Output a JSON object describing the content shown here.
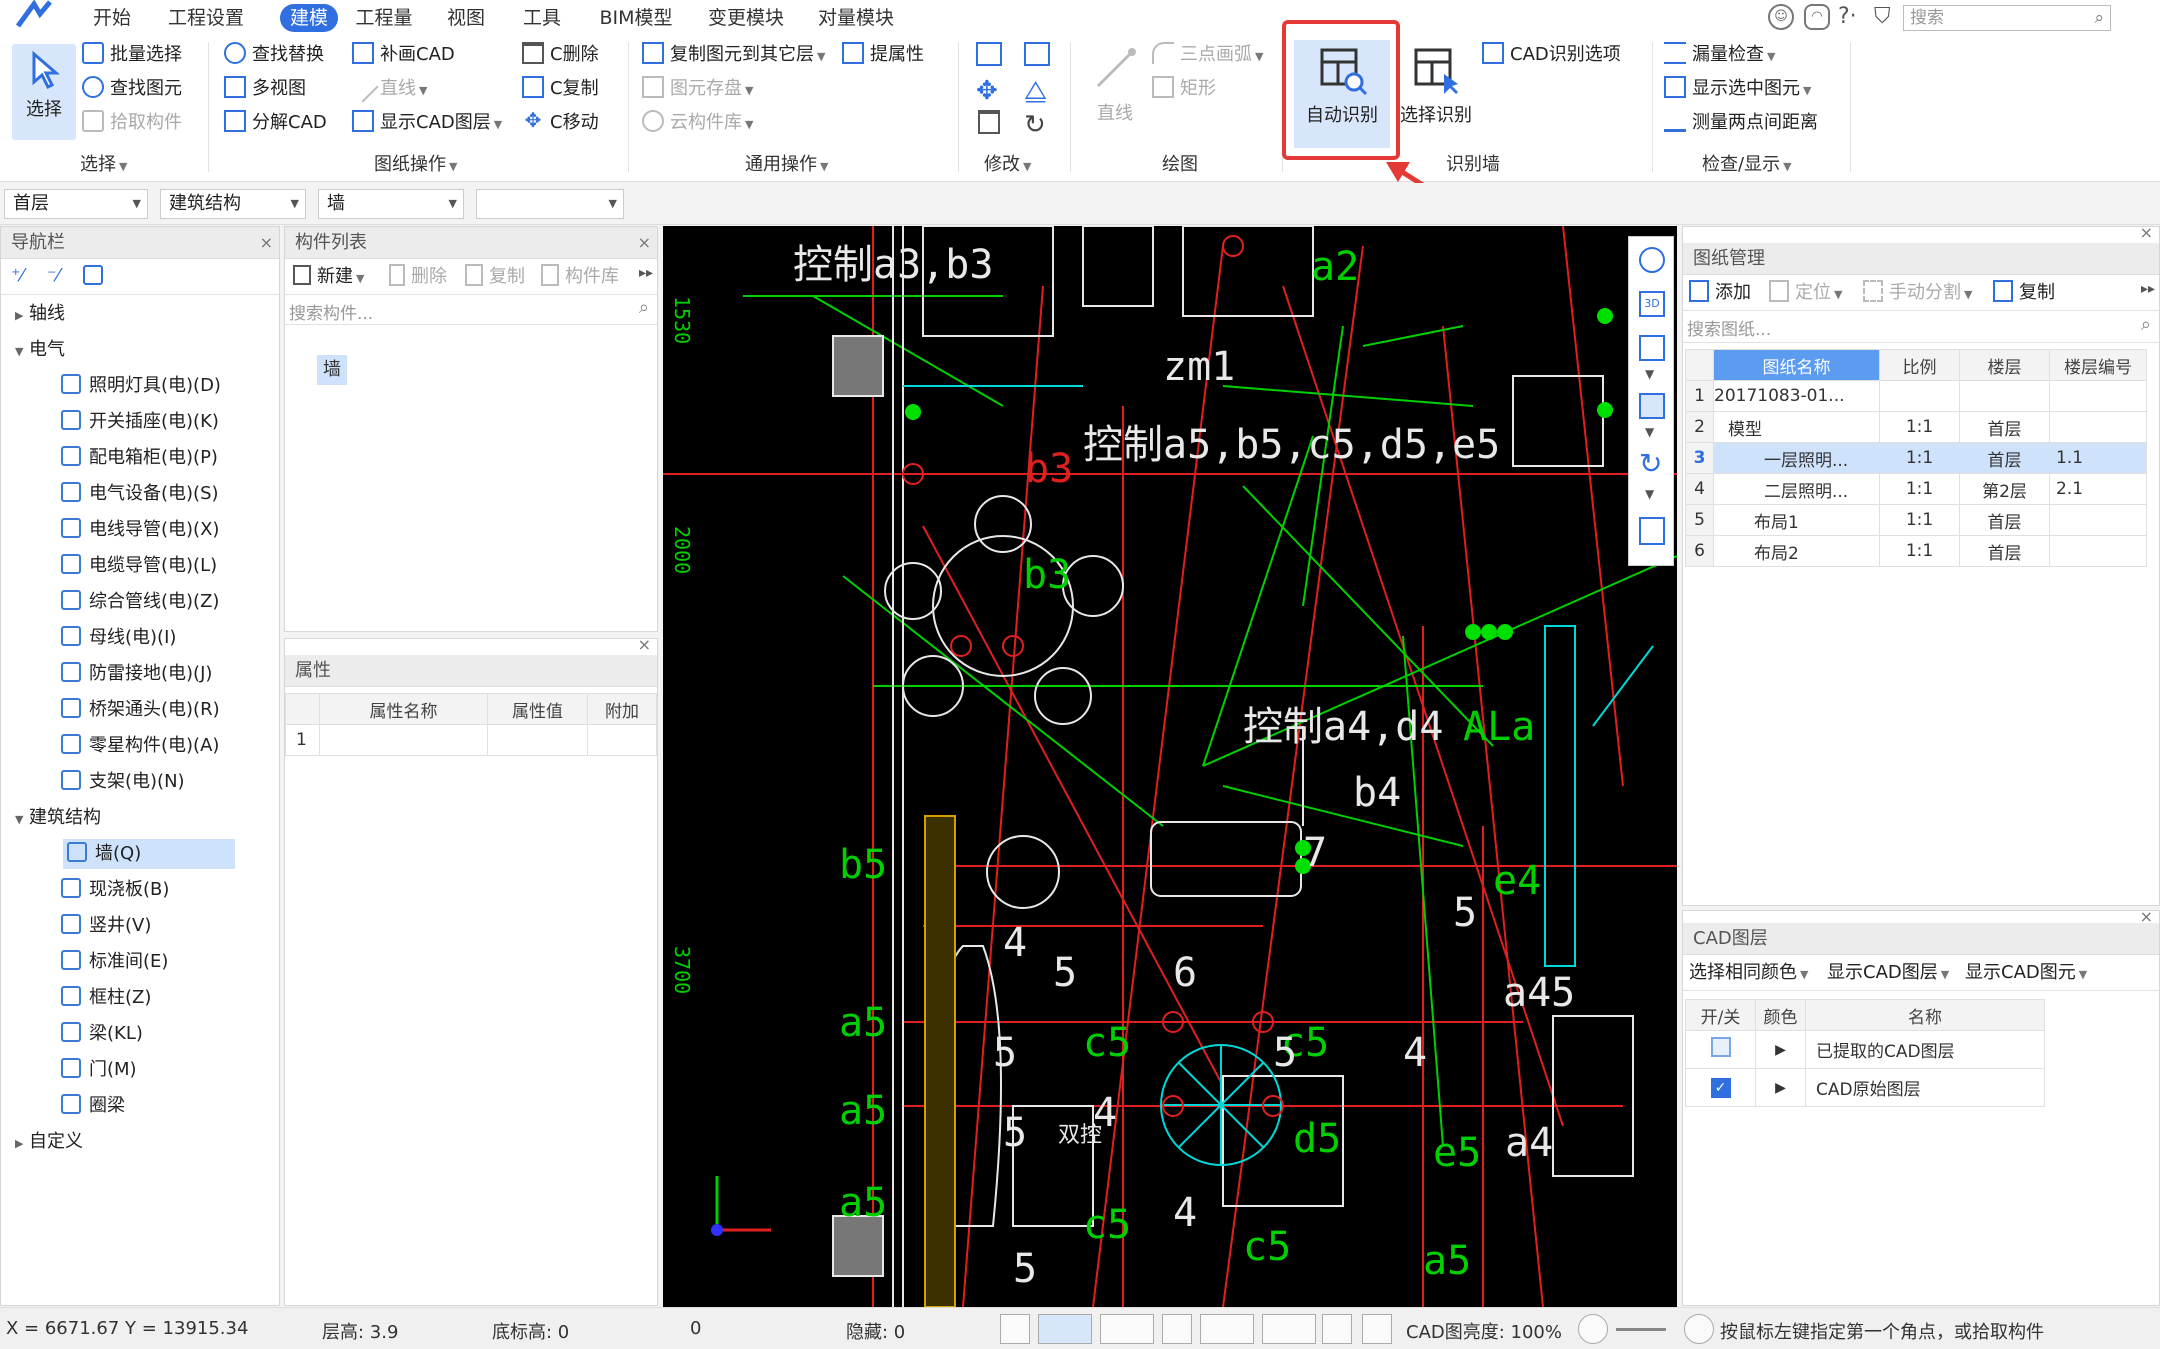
{
  "menu": {
    "tabs": [
      "开始",
      "工程设置",
      "建模",
      "工程量",
      "视图",
      "工具",
      "BIM模型",
      "变更模块",
      "对量模块"
    ],
    "active_tab": "建模",
    "search_placeholder": "搜索"
  },
  "ribbon": {
    "select_group": {
      "big_button": "选择",
      "items": [
        "批量选择",
        "查找图元",
        "拾取构件"
      ],
      "label": "选择"
    },
    "drawing_ops": {
      "items": [
        "查找替换",
        "多视图",
        "分解CAD",
        "补画CAD",
        "直线",
        "显示CAD图层",
        "C删除",
        "C复制",
        "C移动"
      ],
      "label": "图纸操作"
    },
    "general_ops": {
      "items": [
        "复制图元到其它层",
        "提属性",
        "图元存盘",
        "云构件库"
      ],
      "label": "通用操作"
    },
    "modify": {
      "label": "修改"
    },
    "draw": {
      "items": [
        "直线",
        "三点画弧",
        "矩形"
      ],
      "label": "绘图"
    },
    "recognize_wall": {
      "auto_recognize": "自动识别",
      "select_recognize": "选择识别",
      "cad_option": "CAD识别选项",
      "label": "识别墙"
    },
    "check_display": {
      "items": [
        "漏量检查",
        "显示选中图元",
        "测量两点间距离"
      ],
      "label": "检查/显示"
    }
  },
  "selectors": [
    "首层",
    "建筑结构",
    "墙",
    ""
  ],
  "nav": {
    "title": "导航栏",
    "tree": [
      {
        "label": "轴线",
        "level": 0,
        "expanded": false
      },
      {
        "label": "电气",
        "level": 0,
        "expanded": true
      },
      {
        "label": "照明灯具(电)(D)",
        "level": 1
      },
      {
        "label": "开关插座(电)(K)",
        "level": 1
      },
      {
        "label": "配电箱柜(电)(P)",
        "level": 1
      },
      {
        "label": "电气设备(电)(S)",
        "level": 1
      },
      {
        "label": "电线导管(电)(X)",
        "level": 1
      },
      {
        "label": "电缆导管(电)(L)",
        "level": 1
      },
      {
        "label": "综合管线(电)(Z)",
        "level": 1
      },
      {
        "label": "母线(电)(I)",
        "level": 1
      },
      {
        "label": "防雷接地(电)(J)",
        "level": 1
      },
      {
        "label": "桥架通头(电)(R)",
        "level": 1
      },
      {
        "label": "零星构件(电)(A)",
        "level": 1
      },
      {
        "label": "支架(电)(N)",
        "level": 1
      },
      {
        "label": "建筑结构",
        "level": 0,
        "expanded": true
      },
      {
        "label": "墙(Q)",
        "level": 1,
        "selected": true
      },
      {
        "label": "现浇板(B)",
        "level": 1
      },
      {
        "label": "竖井(V)",
        "level": 1
      },
      {
        "label": "标准间(E)",
        "level": 1
      },
      {
        "label": "框柱(Z)",
        "level": 1
      },
      {
        "label": "梁(KL)",
        "level": 1
      },
      {
        "label": "门(M)",
        "level": 1
      },
      {
        "label": "圈梁",
        "level": 1
      },
      {
        "label": "自定义",
        "level": 0,
        "expanded": false
      }
    ]
  },
  "component_list": {
    "title": "构件列表",
    "toolbar": [
      "新建",
      "删除",
      "复制",
      "构件库"
    ],
    "search_placeholder": "搜索构件...",
    "items": [
      "墙"
    ]
  },
  "properties": {
    "title": "属性",
    "columns": [
      "属性名称",
      "属性值",
      "附加"
    ],
    "rows": [
      [
        "1",
        "",
        ""
      ]
    ]
  },
  "drawing_mgmt": {
    "title": "图纸管理",
    "toolbar": [
      "添加",
      "定位",
      "手动分割",
      "复制"
    ],
    "search_placeholder": "搜索图纸...",
    "columns": [
      "图纸名称",
      "比例",
      "楼层",
      "楼层编号"
    ],
    "rows": [
      {
        "no": "1",
        "name": "20171083-01...",
        "scale": "",
        "floor": "",
        "code": ""
      },
      {
        "no": "2",
        "name": "模型",
        "scale": "1:1",
        "floor": "首层",
        "code": ""
      },
      {
        "no": "3",
        "name": "一层照明...",
        "scale": "1:1",
        "floor": "首层",
        "code": "1.1"
      },
      {
        "no": "4",
        "name": "二层照明...",
        "scale": "1:1",
        "floor": "第2层",
        "code": "2.1"
      },
      {
        "no": "5",
        "name": "布局1",
        "scale": "1:1",
        "floor": "首层",
        "code": ""
      },
      {
        "no": "6",
        "name": "布局2",
        "scale": "1:1",
        "floor": "首层",
        "code": ""
      }
    ]
  },
  "cad_layers": {
    "title": "CAD图层",
    "toolbar": [
      "选择相同颜色",
      "显示CAD图层",
      "显示CAD图元"
    ],
    "columns": [
      "开/关",
      "颜色",
      "名称"
    ],
    "rows": [
      {
        "on": false,
        "name": "已提取的CAD图层"
      },
      {
        "on": true,
        "name": "CAD原始图层"
      }
    ]
  },
  "cad_text": {
    "ctl_a3b3": "控制a3,b3",
    "a2": "a2",
    "zm1": "zm1",
    "b3": "b3",
    "ctl_a5": "控制a5,b5,c5,d5,e5",
    "b3_center": "b3",
    "ctl_a4": "控制a4,d4",
    "b4": "b4",
    "ala": "ALa",
    "b5": "b5",
    "e4": "e4",
    "a5_1": "a5",
    "a5_2": "a5",
    "a5_3": "a5",
    "c5_1": "c5",
    "c5_2": "c5",
    "c5_3": "c5",
    "c5_4": "c5",
    "d5": "d5",
    "e5": "e5",
    "a4_45": "a45",
    "a4": "a4",
    "shuangkong": "双控",
    "n1530": "1530",
    "n2000": "2000",
    "n3700": "3700"
  },
  "status": {
    "coords": "X = 6671.67 Y = 13915.34",
    "floor_height": "层高: 3.9",
    "base_height": "底标高: 0",
    "zero": "0",
    "hidden": "隐藏: 0",
    "cad_brightness": "CAD图亮度: 100%",
    "hint": "按鼠标左键指定第一个角点，或拾取构件"
  },
  "colors": {
    "accent": "#2f6fe0",
    "highlight_box": "#e53935",
    "cad_bg": "#000000",
    "cad_green": "#00d000",
    "cad_red": "#e02020",
    "cad_white": "#e8e8e8"
  }
}
